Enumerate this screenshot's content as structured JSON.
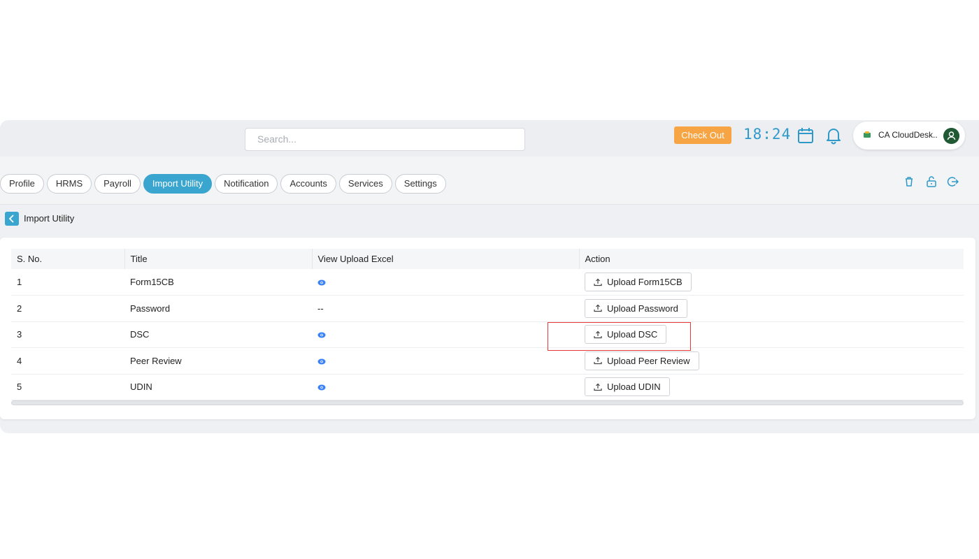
{
  "header": {
    "search_placeholder": "Search...",
    "checkout_label": "Check Out",
    "clock": "18:24",
    "user_name": "CA CloudDesk..",
    "colors": {
      "accent": "#3aa6cf",
      "checkout": "#f7a445",
      "highlight": "#e53935"
    }
  },
  "tabs": [
    {
      "label": "Profile",
      "active": false
    },
    {
      "label": "HRMS",
      "active": false
    },
    {
      "label": "Payroll",
      "active": false
    },
    {
      "label": "Import Utility",
      "active": true
    },
    {
      "label": "Notification",
      "active": false
    },
    {
      "label": "Accounts",
      "active": false
    },
    {
      "label": "Services",
      "active": false
    },
    {
      "label": "Settings",
      "active": false
    }
  ],
  "toolbar_icons": [
    "trash-icon",
    "unlock-icon",
    "logout-icon"
  ],
  "breadcrumb": {
    "label": "Import Utility"
  },
  "table": {
    "headers": [
      "S. No.",
      "Title",
      "View Upload Excel",
      "Action"
    ],
    "rows": [
      {
        "sno": "1",
        "title": "Form15CB",
        "view": "eye",
        "action": "Upload Form15CB"
      },
      {
        "sno": "2",
        "title": "Password",
        "view": "--",
        "action": "Upload Password"
      },
      {
        "sno": "3",
        "title": "DSC",
        "view": "eye",
        "action": "Upload DSC"
      },
      {
        "sno": "4",
        "title": "Peer Review",
        "view": "eye",
        "action": "Upload Peer Review"
      },
      {
        "sno": "5",
        "title": "UDIN",
        "view": "eye",
        "action": "Upload UDIN"
      }
    ]
  }
}
